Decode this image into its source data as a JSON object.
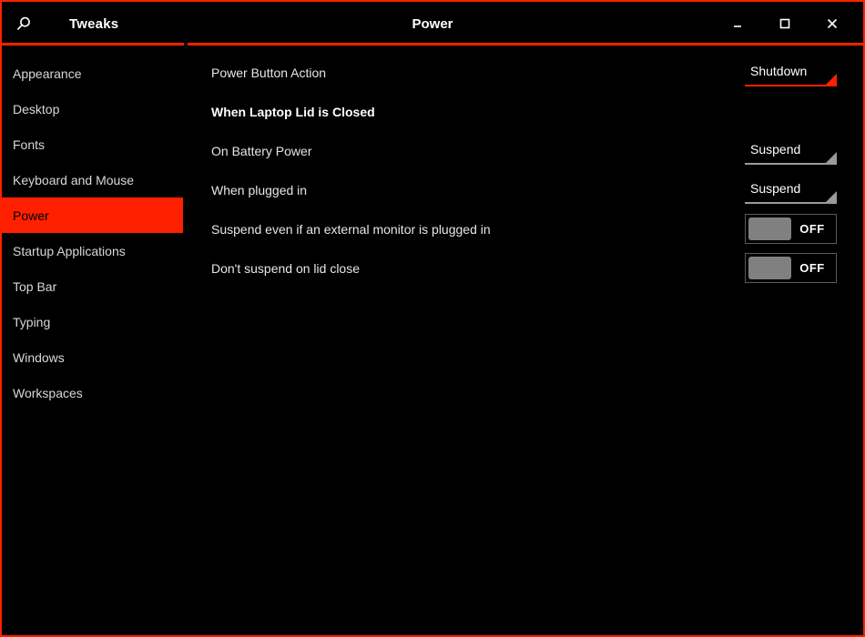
{
  "window": {
    "app_title": "Tweaks",
    "page_title": "Power",
    "accent_color": "#ff2000",
    "background_color": "#000000",
    "search_icon": "search-icon",
    "minimize_icon": "minimize-icon",
    "maximize_icon": "maximize-icon",
    "close_icon": "close-icon"
  },
  "sidebar": {
    "items": [
      {
        "label": "Appearance",
        "selected": false
      },
      {
        "label": "Desktop",
        "selected": false
      },
      {
        "label": "Fonts",
        "selected": false
      },
      {
        "label": "Keyboard and Mouse",
        "selected": false
      },
      {
        "label": "Power",
        "selected": true
      },
      {
        "label": "Startup Applications",
        "selected": false
      },
      {
        "label": "Top Bar",
        "selected": false
      },
      {
        "label": "Typing",
        "selected": false
      },
      {
        "label": "Windows",
        "selected": false
      },
      {
        "label": "Workspaces",
        "selected": false
      }
    ]
  },
  "main": {
    "rows": [
      {
        "label": "Power Button Action",
        "type": "dropdown",
        "value": "Shutdown",
        "accent": true
      },
      {
        "label": "When Laptop Lid is Closed",
        "type": "section",
        "value": ""
      },
      {
        "label": "On Battery Power",
        "type": "dropdown",
        "value": "Suspend",
        "accent": false
      },
      {
        "label": "When plugged in",
        "type": "dropdown",
        "value": "Suspend",
        "accent": false
      },
      {
        "label": "Suspend even if an external monitor is plugged in",
        "type": "toggle",
        "value": "OFF"
      },
      {
        "label": "Don't suspend on lid close",
        "type": "toggle",
        "value": "OFF"
      }
    ]
  }
}
